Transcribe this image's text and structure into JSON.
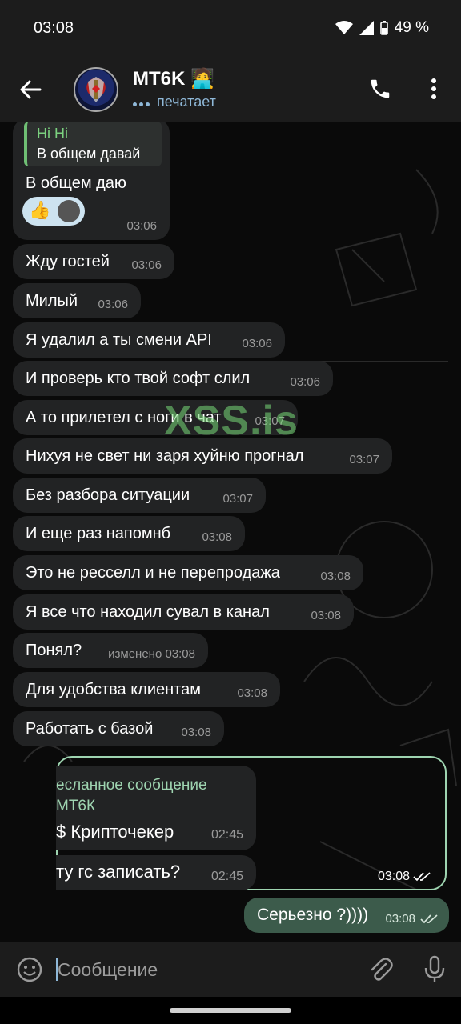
{
  "status_bar": {
    "time": "03:08",
    "battery": "49 %"
  },
  "header": {
    "title": "MT6K",
    "title_emoji": "🧑‍💻",
    "status": "печатает"
  },
  "messages": [
    {
      "reply_name": "Hi Hi",
      "reply_text": "В общем давай",
      "text": "В общем даю",
      "time": "03:06"
    },
    {
      "text": "Жду гостей",
      "time": "03:06"
    },
    {
      "text": "Милый",
      "time": "03:06"
    },
    {
      "text": "Я удалил а ты смени API",
      "time": "03:06"
    },
    {
      "text": "И проверь кто твой софт слил",
      "time": "03:06"
    },
    {
      "text": "А то прилетел с ноги в чат",
      "time": "03:07"
    },
    {
      "text": "Нихуя не свет ни заря хуйню прогнал",
      "time": "03:07"
    },
    {
      "text": "Без разбора ситуации",
      "time": "03:07"
    },
    {
      "text": "И еще раз напомнб",
      "time": "03:08"
    },
    {
      "text": "Это не ресселл и не перепродажа",
      "time": "03:08"
    },
    {
      "text": "Я все что находил сувал в канал",
      "time": "03:08"
    },
    {
      "text": "Понял?",
      "time": "изменено 03:08"
    },
    {
      "text": "Для удобства клиентам",
      "time": "03:08"
    },
    {
      "text": "Работать с базой",
      "time": "03:08"
    }
  ],
  "forwarded": {
    "header": "есланное сообщение",
    "from": "МТ6К",
    "items": [
      {
        "text": "$ Крипточекер",
        "time": "02:45"
      },
      {
        "text": "ту гс записать?",
        "time": "02:45"
      }
    ],
    "time": "03:08"
  },
  "outgoing": {
    "text": "Серьезно ?))))",
    "time": "03:08"
  },
  "watermark": "XSS.is",
  "composer": {
    "placeholder": "Сообщение"
  },
  "icons": {
    "back": "arrow-back-icon",
    "call": "phone-icon",
    "more": "more-vert-icon",
    "emoji": "emoji-icon",
    "attach": "paperclip-icon",
    "mic": "microphone-icon"
  },
  "colors": {
    "incoming_bubble": "#222324",
    "outgoing_bubble": "#3c5b4b",
    "accent_green": "#7bd17f"
  }
}
